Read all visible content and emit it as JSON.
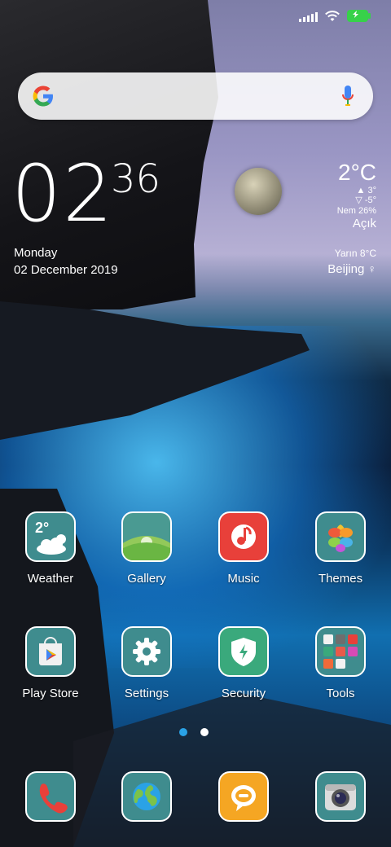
{
  "status_bar": {
    "signal_icon": "signal-icon",
    "wifi_icon": "wifi-icon",
    "battery_icon": "battery-icon"
  },
  "search": {
    "logo": "G",
    "mic_icon": "mic-icon"
  },
  "clock": {
    "hours": "02",
    "minutes": "36",
    "day": "Monday",
    "date": "02 December 2019"
  },
  "weather": {
    "temp": "2°C",
    "high": "3°",
    "low": "-5°",
    "humidity": "Nem 26%",
    "condition": "Açık",
    "tomorrow": "Yarın 8°C",
    "city": "Beijing"
  },
  "apps": [
    {
      "label": "Weather",
      "icon": "weather-icon",
      "badge": "2°"
    },
    {
      "label": "Gallery",
      "icon": "gallery-icon"
    },
    {
      "label": "Music",
      "icon": "music-icon"
    },
    {
      "label": "Themes",
      "icon": "themes-icon"
    },
    {
      "label": "Play Store",
      "icon": "play-store-icon"
    },
    {
      "label": "Settings",
      "icon": "settings-icon"
    },
    {
      "label": "Security",
      "icon": "security-icon"
    },
    {
      "label": "Tools",
      "icon": "tools-folder-icon"
    }
  ],
  "dock": [
    {
      "icon": "phone-icon"
    },
    {
      "icon": "browser-icon"
    },
    {
      "icon": "messaging-icon"
    },
    {
      "icon": "camera-icon"
    }
  ],
  "colors": {
    "teal": "#3f8c8e",
    "accent_blue": "#2aa2e6"
  }
}
